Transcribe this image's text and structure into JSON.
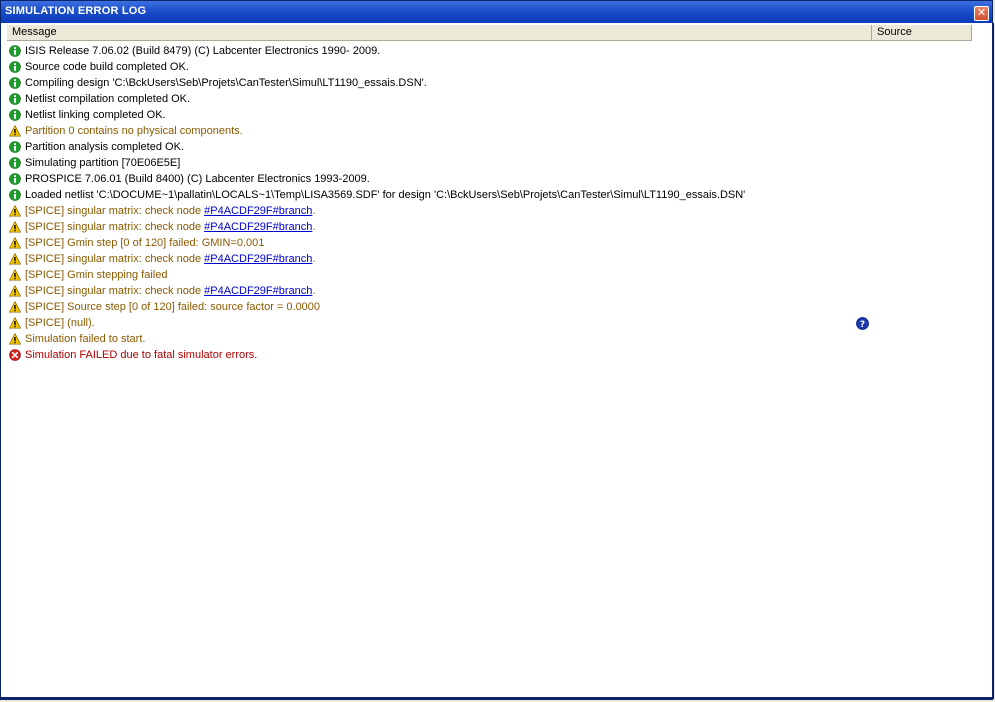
{
  "window": {
    "title": "SIMULATION ERROR LOG",
    "close_label": "✕"
  },
  "columns": {
    "message": "Message",
    "source": "Source"
  },
  "colors": {
    "info": "#1e9e2e",
    "warning": "#f2c200",
    "error": "#d82020",
    "help": "#1a3ab0"
  },
  "rows": [
    {
      "type": "info",
      "text": "ISIS Release 7.06.02 (Build 8479) (C) Labcenter Electronics 1990- 2009."
    },
    {
      "type": "info",
      "text": "Source code build completed OK."
    },
    {
      "type": "info",
      "text": "Compiling design 'C:\\BckUsers\\Seb\\Projets\\CanTester\\Simul\\LT1190_essais.DSN'."
    },
    {
      "type": "info",
      "text": "Netlist compilation completed OK."
    },
    {
      "type": "info",
      "text": "Netlist linking completed OK."
    },
    {
      "type": "warning",
      "text": "Partition 0 contains no physical components."
    },
    {
      "type": "info",
      "text": "Partition analysis completed OK."
    },
    {
      "type": "info",
      "text": "Simulating partition [70E06E5E]"
    },
    {
      "type": "info",
      "text": "PROSPICE 7.06.01 (Build 8400) (C) Labcenter Electronics 1993-2009."
    },
    {
      "type": "info",
      "text": "Loaded netlist 'C:\\DOCUME~1\\pallatin\\LOCALS~1\\Temp\\LISA3569.SDF' for design 'C:\\BckUsers\\Seb\\Projets\\CanTester\\Simul\\LT1190_essais.DSN'"
    },
    {
      "type": "warning",
      "text": "[SPICE] singular matrix: check node ",
      "link": "#P4ACDF29F#branch",
      "suffix": "."
    },
    {
      "type": "warning",
      "text": "[SPICE] singular matrix: check node ",
      "link": "#P4ACDF29F#branch",
      "suffix": "."
    },
    {
      "type": "warning",
      "text": "[SPICE] Gmin step [0 of 120] failed: GMIN=0.001"
    },
    {
      "type": "warning",
      "text": "[SPICE] singular matrix: check node ",
      "link": "#P4ACDF29F#branch",
      "suffix": "."
    },
    {
      "type": "warning",
      "text": "[SPICE] Gmin stepping failed"
    },
    {
      "type": "warning",
      "text": "[SPICE] singular matrix: check node ",
      "link": "#P4ACDF29F#branch",
      "suffix": "."
    },
    {
      "type": "warning",
      "text": "[SPICE] Source step [0 of 120] failed: source factor =   0.0000"
    },
    {
      "type": "warning",
      "text": "[SPICE] (null)."
    },
    {
      "type": "warning",
      "text": "Simulation failed to start."
    },
    {
      "type": "error",
      "text": "Simulation FAILED due to fatal simulator errors."
    }
  ]
}
